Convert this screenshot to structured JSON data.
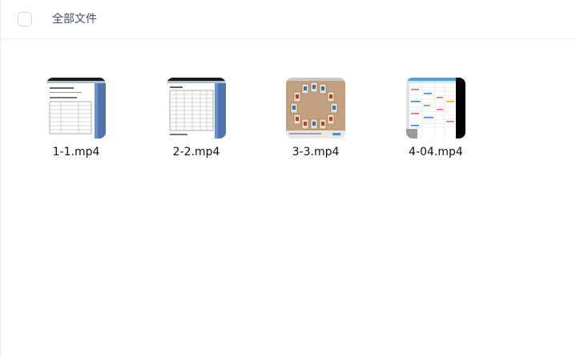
{
  "header": {
    "title": "全部文件"
  },
  "files": [
    {
      "name": "1-1.mp4",
      "thumbnail": "document-table-screenshot"
    },
    {
      "name": "2-2.mp4",
      "thumbnail": "spreadsheet-screenshot"
    },
    {
      "name": "3-3.mp4",
      "thumbnail": "tarot-cards-screenshot"
    },
    {
      "name": "4-04.mp4",
      "thumbnail": "colored-spreadsheet-screenshot"
    }
  ],
  "colors": {
    "title_text": "#424e67",
    "file_name_text": "#111111",
    "divider": "#eeeeee"
  }
}
